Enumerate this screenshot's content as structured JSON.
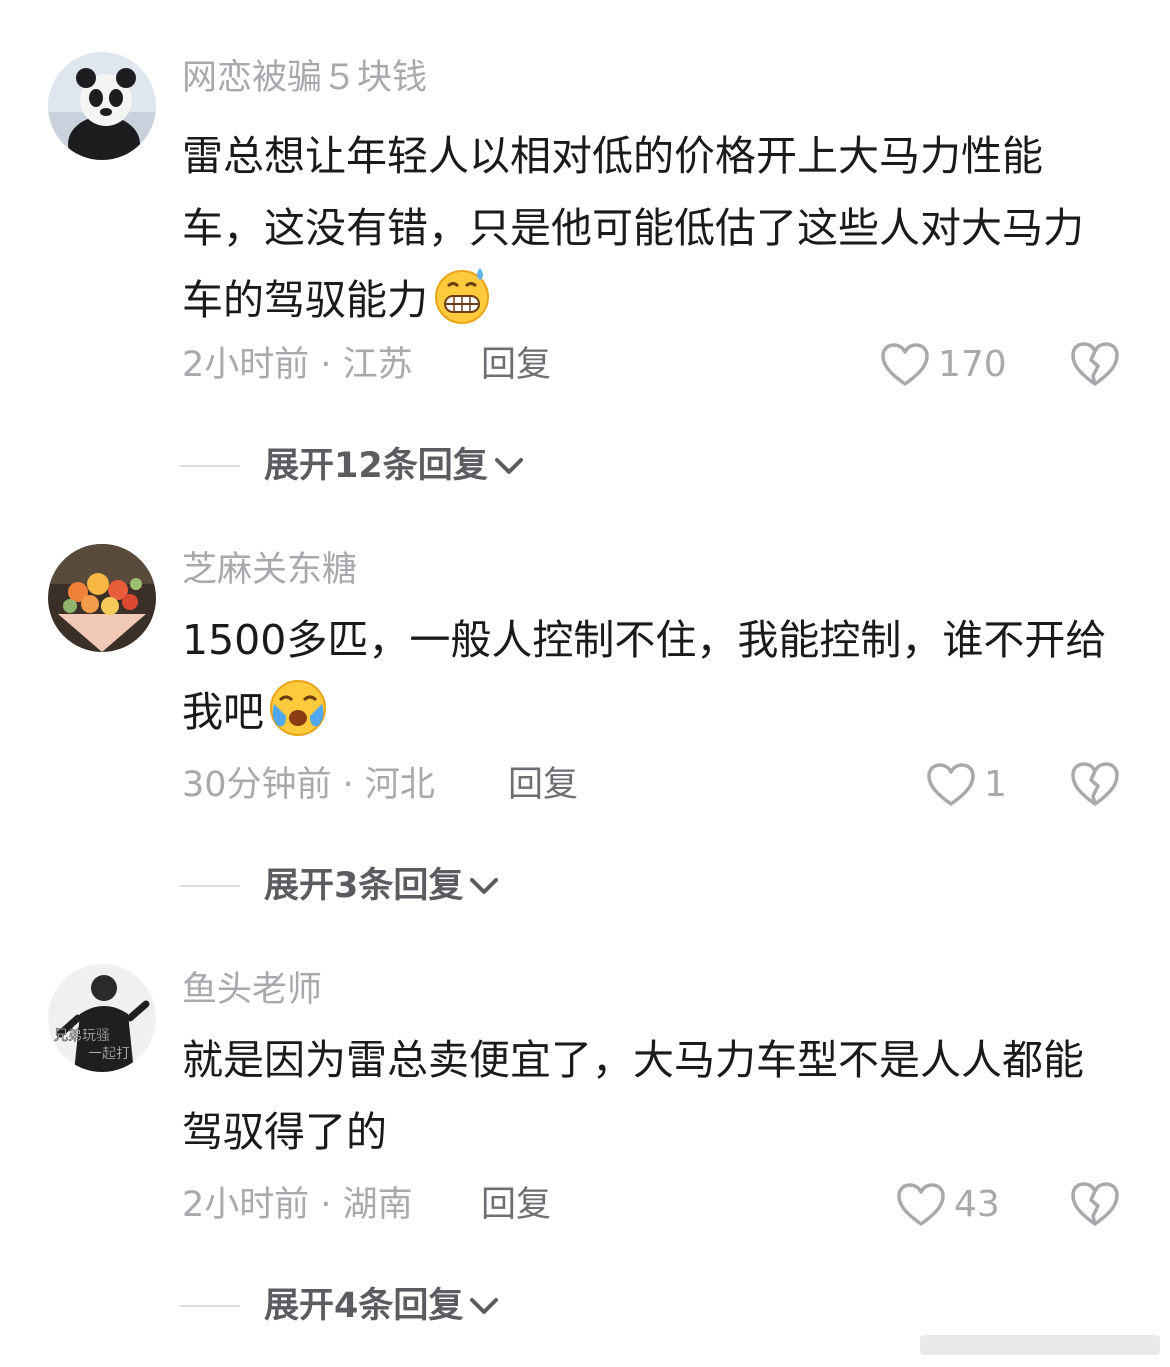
{
  "comments": [
    {
      "username": "网恋被骗５块钱",
      "text": "雷总想让年轻人以相对低的价格开上大马力性能车，这没有错，只是他可能低估了这些人对大马力车的驾驭能力",
      "emoji": "grimacing-sweat-emoji",
      "time_location": "2小时前 · 江苏",
      "reply_label": "回复",
      "likes": "170",
      "expand_label": "展开12条回复"
    },
    {
      "username": "芝麻关东糖",
      "text": "1500多匹，一般人控制不住，我能控制，谁不开给我吧",
      "emoji": "crying-emoji",
      "time_location": "30分钟前 · 河北",
      "reply_label": "回复",
      "likes": "1",
      "expand_label": "展开3条回复"
    },
    {
      "username": "鱼头老师",
      "text": "就是因为雷总卖便宜了，大马力车型不是人人都能驾驭得了的",
      "time_location": "2小时前 · 湖南",
      "reply_label": "回复",
      "likes": "43",
      "expand_label": "展开4条回复",
      "avatar_caption": [
        "兄弟玩骚",
        "一起打"
      ]
    }
  ]
}
